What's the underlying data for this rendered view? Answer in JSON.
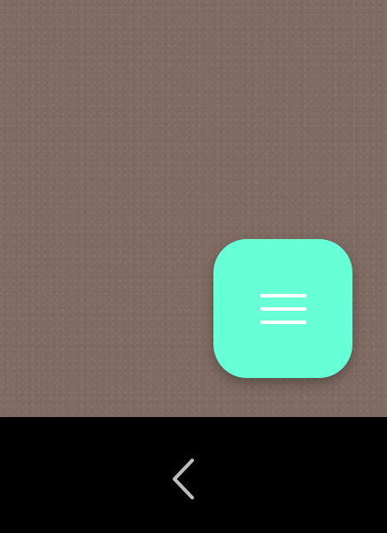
{
  "screen": {
    "camera_view": {
      "background_color": "#7f6b63"
    },
    "menu_button": {
      "icon": "hamburger-icon",
      "color": "#66ffd6",
      "icon_color": "#ffffff"
    },
    "nav_bar": {
      "background_color": "#000000",
      "back_icon": "chevron-left-icon",
      "back_icon_color": "#bdbdbd"
    }
  }
}
